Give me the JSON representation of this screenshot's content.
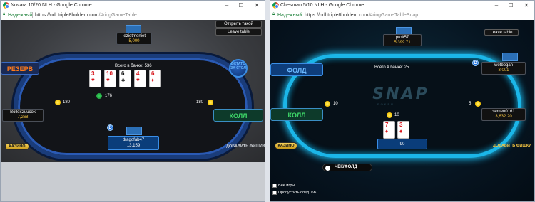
{
  "left": {
    "title": "Novara 10/20 NLH - Google Chrome",
    "secure": "Надежный",
    "url_host": "https://ndl.triple8holdem.com",
    "url_path": "/#ringGameTable",
    "buttons": {
      "open_other": "Открыть такой",
      "leave": "Leave table"
    },
    "pot": "Всего в банке: 536",
    "pot_sub": "176",
    "board": [
      {
        "rank": "3",
        "suit": "♥",
        "color": "red"
      },
      {
        "rank": "10",
        "suit": "♥",
        "color": "red"
      },
      {
        "rank": "6",
        "suit": "♣",
        "color": "black"
      },
      {
        "rank": "4",
        "suit": "♥",
        "color": "red"
      },
      {
        "rank": "6",
        "suit": "♦",
        "color": "red"
      }
    ],
    "players": {
      "top": {
        "name": "jezietmeniet",
        "stack": "5,000"
      },
      "left": {
        "name": "Bollox2uucok",
        "stack": "7,268",
        "bet": "180"
      },
      "right": {
        "bet": "180"
      },
      "hero": {
        "name": "dragofab47",
        "stack": "13,159"
      }
    },
    "actions": {
      "reserve": "РЕЗЕРВ",
      "call": "КОЛЛ"
    },
    "bubble": "ВСТАТЬ ЗА СТОЛ",
    "dealer": "D",
    "casino": "КАЗИНО",
    "add_chips": "ДОБАВИТЬ ФИШКИ"
  },
  "right": {
    "title": "Chesman 5/10 NLH - Google Chrome",
    "secure": "Надежный",
    "url_host": "https://ndl.triple8holdem.com",
    "url_path": "/#ringGameTableSnap",
    "buttons": {
      "leave": "Leave table"
    },
    "pot": "Всего в банке: 25",
    "players": {
      "top": {
        "name": "prolt57",
        "stack": "5,399.71"
      },
      "right_top": {
        "name": "wotbogan",
        "stack": "3,001"
      },
      "right_bottom": {
        "name": "semen0161",
        "stack": "3,632.20",
        "bet": "5"
      },
      "left_bet": "10",
      "center_bet": "10",
      "hero_stack": "90"
    },
    "hero_cards": [
      {
        "rank": "7",
        "suit": "♦",
        "color": "red"
      },
      {
        "rank": "3",
        "suit": "♦",
        "color": "red"
      }
    ],
    "actions": {
      "fold": "ФОЛД",
      "call": "КОЛЛ"
    },
    "dealer": "D",
    "casino": "КАЗИНО",
    "add_chips": "ДОБАВИТЬ ФИШКИ",
    "toggle_label": "ЧЕК/ФОЛД",
    "checkboxes": [
      "Вне игры",
      "Пропустить след. ББ"
    ]
  }
}
